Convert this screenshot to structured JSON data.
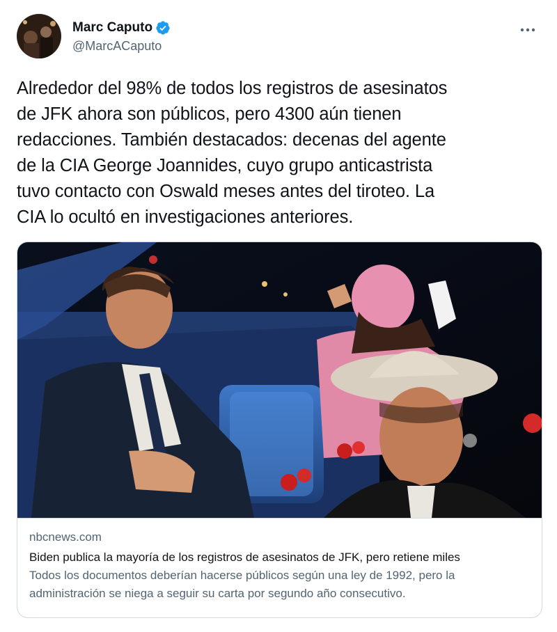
{
  "author": {
    "display_name": "Marc Caputo",
    "handle": "@MarcACaputo",
    "verified": true,
    "avatar_icon": "profile-photo"
  },
  "header": {
    "more_icon": "more-horizontal-icon"
  },
  "tweet": {
    "lines": [
      "Alrededor del 98% de todos los registros de asesinatos",
      "de JFK ahora son públicos, pero 4300 aún tienen",
      "redacciones. También destacados: decenas del agente",
      "de la CIA George Joannides, cuyo grupo anticastrista",
      "tuvo contacto con Oswald meses antes del tiroteo. La",
      "CIA lo ocultó en investigaciones anteriores."
    ]
  },
  "link_card": {
    "domain": "nbcnews.com",
    "title": "Biden publica la mayoría de los registros de asesinatos de JFK, pero retiene miles",
    "description_lines": [
      "Todos los documentos deberían hacerse públicos según una ley de 1992, pero la",
      "administración se niega a seguir su carta por segundo año consecutivo."
    ]
  },
  "colors": {
    "text_primary": "#0f1419",
    "text_secondary": "#536471",
    "border": "#cfd9de",
    "verified_blue": "#1d9bf0"
  }
}
